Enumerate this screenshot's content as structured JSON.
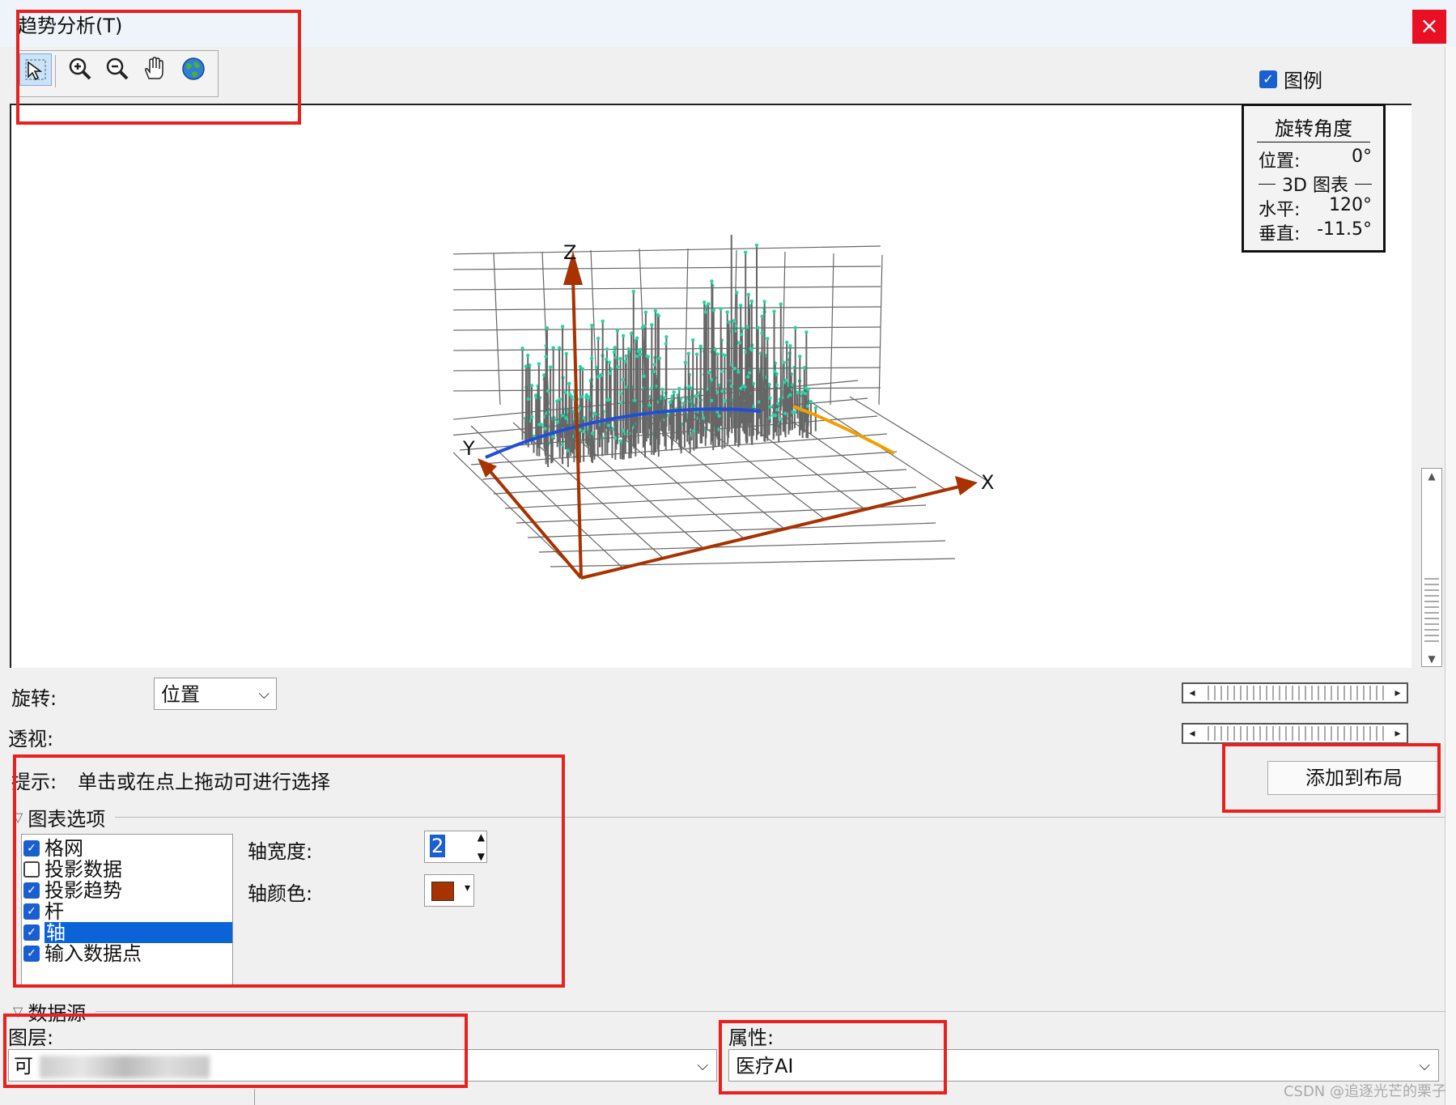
{
  "window": {
    "title": "趋势分析(T)",
    "close_glyph": "×"
  },
  "legend_checkbox": {
    "label": "图例",
    "checked": true
  },
  "rotation_panel": {
    "title": "旋转角度",
    "position_label": "位置:",
    "position_value": "0°",
    "section_label": "3D 图表",
    "horizontal_label": "水平:",
    "horizontal_value": "120°",
    "vertical_label": "垂直:",
    "vertical_value": "-11.5°"
  },
  "axes": {
    "x": "X",
    "y": "Y",
    "z": "Z"
  },
  "controls": {
    "rotate_label": "旋转:",
    "rotate_value": "位置",
    "perspective_label": "透视:",
    "hint_label": "提示:",
    "hint_text": "单击或在点上拖动可进行选择",
    "add_to_layout": "添加到布局"
  },
  "chart_options": {
    "section_label": "图表选项",
    "items": [
      {
        "label": "格网",
        "checked": true,
        "selected": false
      },
      {
        "label": "投影数据",
        "checked": false,
        "selected": false
      },
      {
        "label": "投影趋势",
        "checked": true,
        "selected": false
      },
      {
        "label": "杆",
        "checked": true,
        "selected": false
      },
      {
        "label": "轴",
        "checked": true,
        "selected": true
      },
      {
        "label": "输入数据点",
        "checked": true,
        "selected": false
      }
    ],
    "axis_width_label": "轴宽度:",
    "axis_width_value": "2",
    "axis_color_label": "轴颜色:",
    "axis_color": "#a83200"
  },
  "data_source": {
    "section_label": "数据源",
    "layer_label": "图层:",
    "layer_value": "可",
    "attribute_label": "属性:",
    "attribute_value": "医疗AI"
  },
  "watermark": "CSDN @追逐光芒的栗子",
  "colors": {
    "accent": "#1a5fd0",
    "highlight": "#e8201e",
    "axis": "#a83200",
    "stems": "#666666",
    "points": "#1fd8a6",
    "trend_blue": "#1f4fd8",
    "trend_orange": "#f0a000"
  }
}
